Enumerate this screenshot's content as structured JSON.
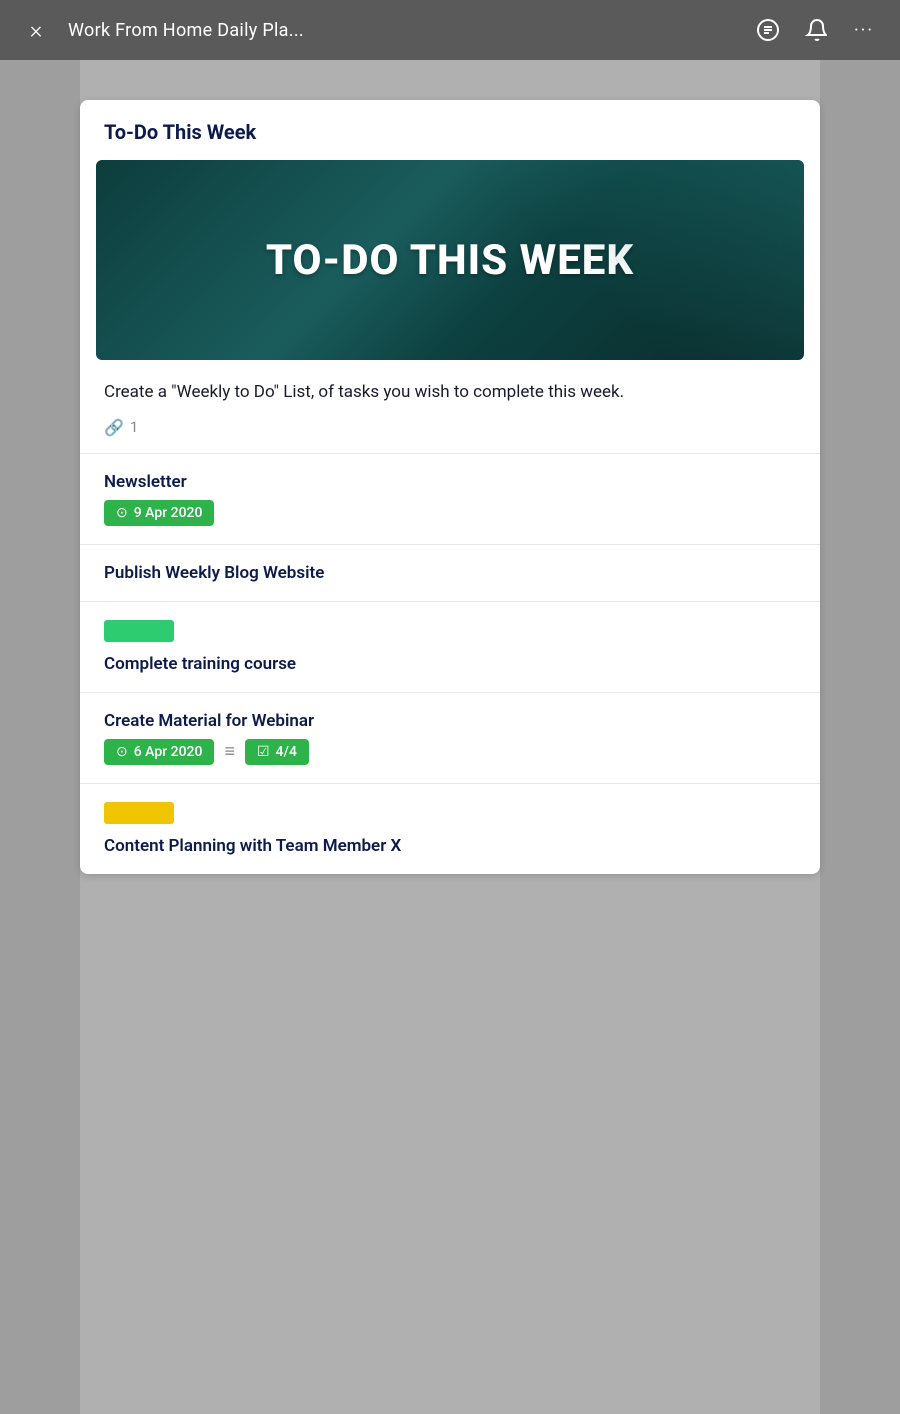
{
  "topBar": {
    "title": "Work From Home Daily Pla...",
    "closeLabel": "×",
    "dotsLabel": "···"
  },
  "card": {
    "title": "To-Do This Week",
    "hero": {
      "text": "TO-DO THIS WEEK"
    },
    "description": {
      "text": "Create a \"Weekly to Do\" List, of tasks you wish to complete this week.",
      "attachment_count": "1"
    },
    "items": [
      {
        "id": "newsletter",
        "title": "Newsletter",
        "badge": "9 Apr 2020",
        "has_badge": true,
        "has_tag": false,
        "tag_color": null,
        "has_checklist": false,
        "has_lines": false
      },
      {
        "id": "publish-blog",
        "title": "Publish Weekly Blog Website",
        "badge": null,
        "has_badge": false,
        "has_tag": false,
        "tag_color": null,
        "has_checklist": false,
        "has_lines": false
      },
      {
        "id": "training",
        "title": "Complete training course",
        "badge": null,
        "has_badge": false,
        "has_tag": true,
        "tag_color": "green",
        "has_checklist": false,
        "has_lines": false
      },
      {
        "id": "webinar",
        "title": "Create Material for Webinar",
        "badge": "6 Apr 2020",
        "has_badge": true,
        "has_tag": false,
        "tag_color": null,
        "has_checklist": true,
        "checklist_label": "4/4",
        "has_lines": true
      },
      {
        "id": "content-planning",
        "title": "Content Planning with Team Member X",
        "badge": null,
        "has_badge": false,
        "has_tag": true,
        "tag_color": "yellow",
        "has_checklist": false,
        "has_lines": false
      }
    ]
  }
}
